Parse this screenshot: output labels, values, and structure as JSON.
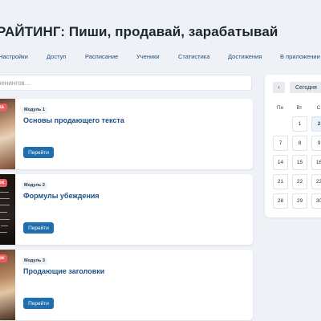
{
  "header": {
    "title": "РАЙТИНГ: Пиши, продавай, зарабатывай"
  },
  "tabs": [
    {
      "label": "Настройки"
    },
    {
      "label": "Доступ"
    },
    {
      "label": "Расписание"
    },
    {
      "label": "Ученики"
    },
    {
      "label": "Статистика"
    },
    {
      "label": "Достижения"
    },
    {
      "label": "В приложении"
    }
  ],
  "search": {
    "placeholder": "ренингов..."
  },
  "modules": [
    {
      "badge": "Модуль 1",
      "title": "Основы продающего текста",
      "ribbon": "ока",
      "button": "Перейти"
    },
    {
      "badge": "Модуль 2",
      "title": "Формулы убеждения",
      "ribbon": "рок",
      "button": "Перейти"
    },
    {
      "badge": "Модуль 3",
      "title": "Продающие заголовки",
      "ribbon": "рок",
      "button": "Перейти"
    }
  ],
  "calendar": {
    "prev_label": "‹",
    "today_label": "Сегодня",
    "weekdays": [
      "Пн",
      "Вт",
      "С"
    ],
    "weeks": [
      [
        "",
        "1",
        "2"
      ],
      [
        "7",
        "8",
        "9"
      ],
      [
        "14",
        "15",
        "16"
      ],
      [
        "21",
        "22",
        "23"
      ],
      [
        "28",
        "29",
        "30"
      ]
    ],
    "today_value": "2"
  }
}
